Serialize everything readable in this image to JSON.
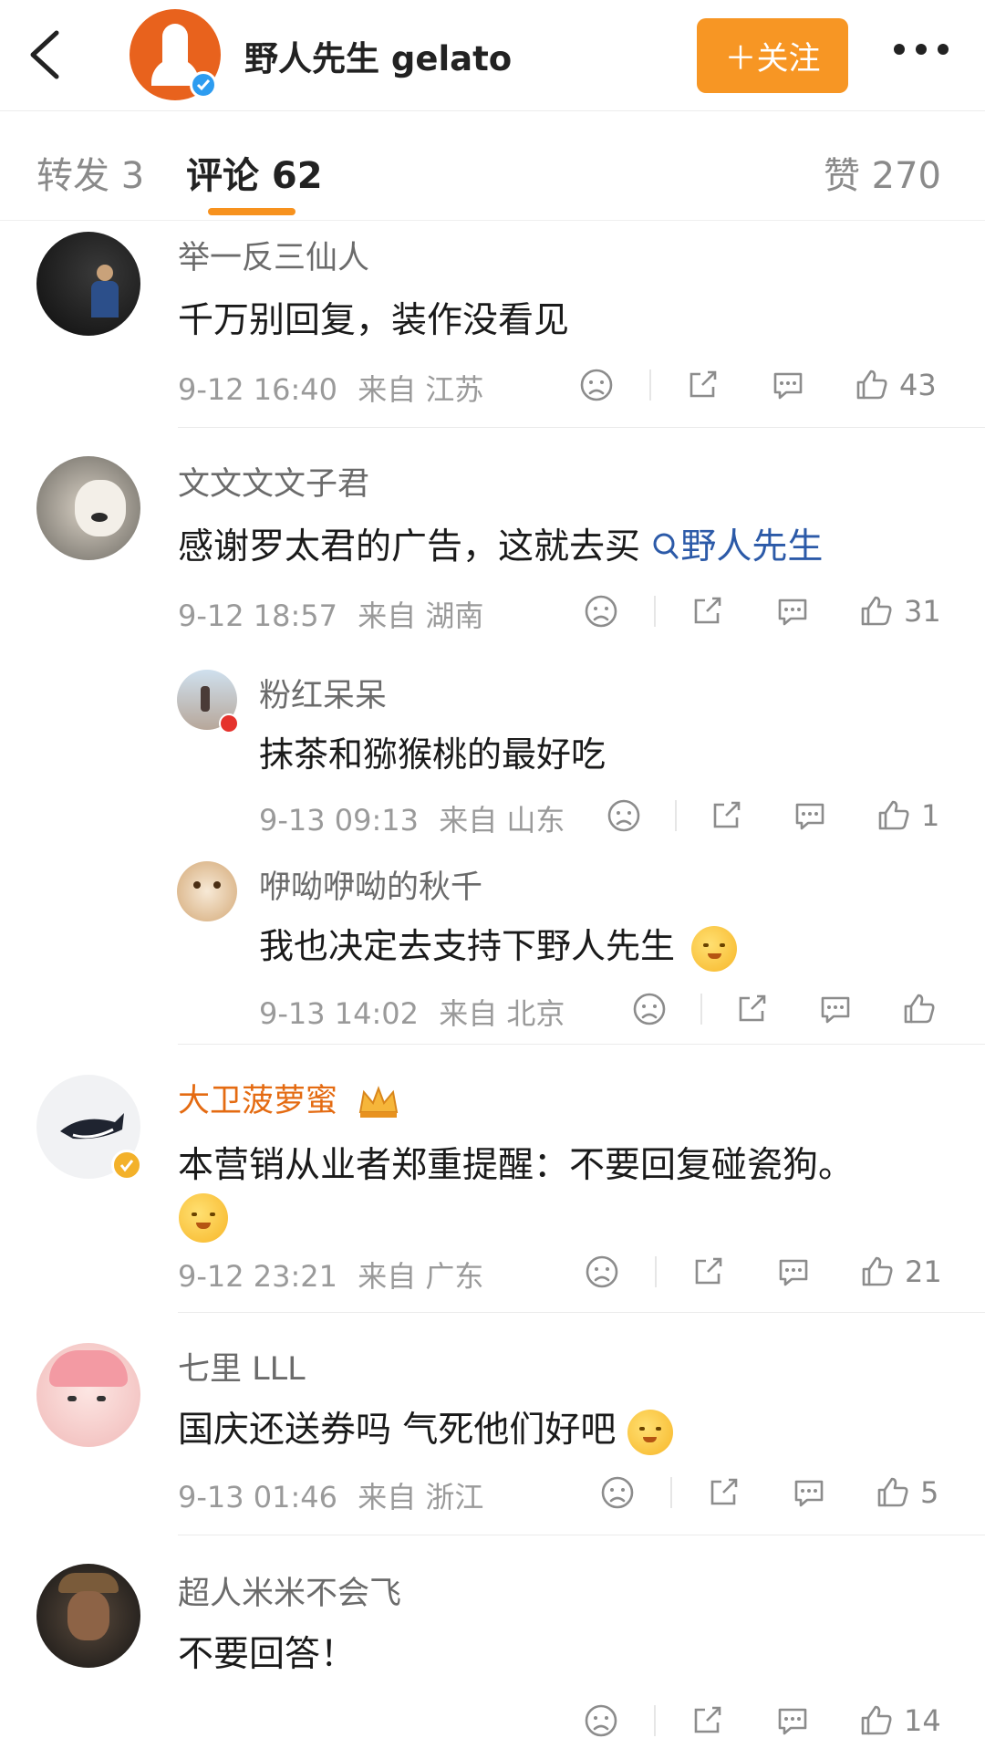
{
  "header": {
    "title": "野人先生 gelato",
    "follow_label": "＋关注"
  },
  "tabs": {
    "repost": "转发 3",
    "comments": "评论 62",
    "likes": "赞 270"
  },
  "colors": {
    "accent": "#f79624",
    "link": "#2c5aa8",
    "vip_name": "#e46b12"
  },
  "comments": [
    {
      "username": "举一反三仙人",
      "text": "千万别回复，装作没看见",
      "time": "9-12 16:40",
      "location": "来自 江苏",
      "likes": "43"
    },
    {
      "username": "文文文文子君",
      "text": "感谢罗太君的广告，这就去买",
      "link_text": "野人先生",
      "time": "9-12 18:57",
      "location": "来自 湖南",
      "likes": "31",
      "replies": [
        {
          "username": "粉红呆呆",
          "text": "抹茶和猕猴桃的最好吃",
          "time": "9-13 09:13",
          "location": "来自 山东",
          "likes": "1"
        },
        {
          "username": "咿呦咿呦的秋千",
          "text": "我也决定去支持下野人先生",
          "time": "9-13 14:02",
          "location": "来自 北京",
          "likes": ""
        }
      ]
    },
    {
      "username": "大卫菠萝蜜",
      "text": "本营销从业者郑重提醒：不要回复碰瓷狗。",
      "time": "9-12 23:21",
      "location": "来自 广东",
      "likes": "21"
    },
    {
      "username": "七里 LLL",
      "text": "国庆还送券吗 气死他们好吧",
      "time": "9-13 01:46",
      "location": "来自 浙江",
      "likes": "5"
    },
    {
      "username": "超人米米不会飞",
      "text": "不要回答！",
      "likes": "14"
    }
  ]
}
